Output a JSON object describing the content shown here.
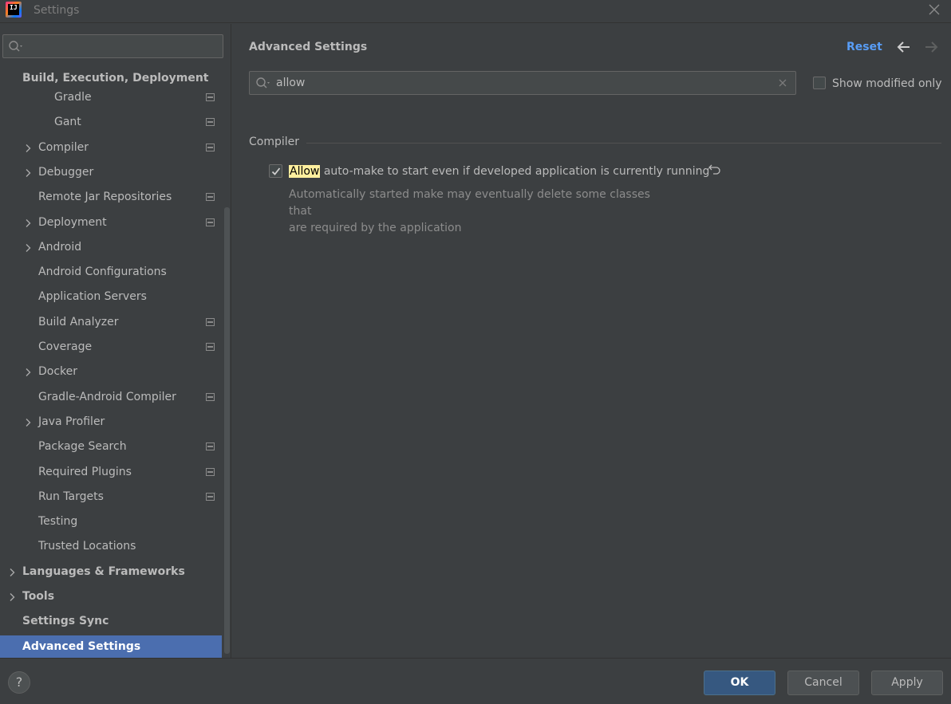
{
  "window": {
    "title": "Settings",
    "app_icon": "intellij-idea-icon",
    "close_icon": "close-icon"
  },
  "sidebar": {
    "search": {
      "value": "",
      "placeholder": ""
    },
    "section_title": "Build, Execution, Deployment",
    "items": [
      {
        "label": "Gradle",
        "indent": 2,
        "expandable": false,
        "project_icon": true,
        "bold": false
      },
      {
        "label": "Gant",
        "indent": 2,
        "expandable": false,
        "project_icon": true,
        "bold": false
      },
      {
        "label": "Compiler",
        "indent": 1,
        "expandable": true,
        "project_icon": true,
        "bold": false
      },
      {
        "label": "Debugger",
        "indent": 1,
        "expandable": true,
        "project_icon": false,
        "bold": false
      },
      {
        "label": "Remote Jar Repositories",
        "indent": 1,
        "expandable": false,
        "project_icon": true,
        "bold": false
      },
      {
        "label": "Deployment",
        "indent": 1,
        "expandable": true,
        "project_icon": true,
        "bold": false
      },
      {
        "label": "Android",
        "indent": 1,
        "expandable": true,
        "project_icon": false,
        "bold": false
      },
      {
        "label": "Android Configurations",
        "indent": 1,
        "expandable": false,
        "project_icon": false,
        "bold": false
      },
      {
        "label": "Application Servers",
        "indent": 1,
        "expandable": false,
        "project_icon": false,
        "bold": false
      },
      {
        "label": "Build Analyzer",
        "indent": 1,
        "expandable": false,
        "project_icon": true,
        "bold": false
      },
      {
        "label": "Coverage",
        "indent": 1,
        "expandable": false,
        "project_icon": true,
        "bold": false
      },
      {
        "label": "Docker",
        "indent": 1,
        "expandable": true,
        "project_icon": false,
        "bold": false
      },
      {
        "label": "Gradle-Android Compiler",
        "indent": 1,
        "expandable": false,
        "project_icon": true,
        "bold": false
      },
      {
        "label": "Java Profiler",
        "indent": 1,
        "expandable": true,
        "project_icon": false,
        "bold": false
      },
      {
        "label": "Package Search",
        "indent": 1,
        "expandable": false,
        "project_icon": true,
        "bold": false
      },
      {
        "label": "Required Plugins",
        "indent": 1,
        "expandable": false,
        "project_icon": true,
        "bold": false
      },
      {
        "label": "Run Targets",
        "indent": 1,
        "expandable": false,
        "project_icon": true,
        "bold": false
      },
      {
        "label": "Testing",
        "indent": 1,
        "expandable": false,
        "project_icon": false,
        "bold": false
      },
      {
        "label": "Trusted Locations",
        "indent": 1,
        "expandable": false,
        "project_icon": false,
        "bold": false
      },
      {
        "label": "Languages & Frameworks",
        "indent": 0,
        "expandable": true,
        "project_icon": false,
        "bold": true
      },
      {
        "label": "Tools",
        "indent": 0,
        "expandable": true,
        "project_icon": false,
        "bold": true
      },
      {
        "label": "Settings Sync",
        "indent": 0,
        "expandable": false,
        "project_icon": false,
        "bold": true
      },
      {
        "label": "Advanced Settings",
        "indent": 0,
        "expandable": false,
        "project_icon": false,
        "bold": true,
        "selected": true
      }
    ]
  },
  "content": {
    "title": "Advanced Settings",
    "reset_label": "Reset",
    "back_icon": "arrow-left-icon",
    "forward_icon": "arrow-right-icon",
    "search": {
      "value": "allow",
      "placeholder": ""
    },
    "show_modified_label": "Show modified only",
    "show_modified_checked": false,
    "group_title": "Compiler",
    "option": {
      "highlight": "Allow",
      "rest": " auto-make to start even if developed application is currently running",
      "checked": true,
      "description_line1": "Automatically started make may eventually delete some classes that",
      "description_line2": "are required by the application"
    }
  },
  "footer": {
    "help_label": "?",
    "ok_label": "OK",
    "cancel_label": "Cancel",
    "apply_label": "Apply"
  },
  "colors": {
    "background": "#3c3f41",
    "selection": "#4b6eaf",
    "link": "#589df6",
    "highlight": "#ffef9e",
    "primary_button": "#365880"
  }
}
